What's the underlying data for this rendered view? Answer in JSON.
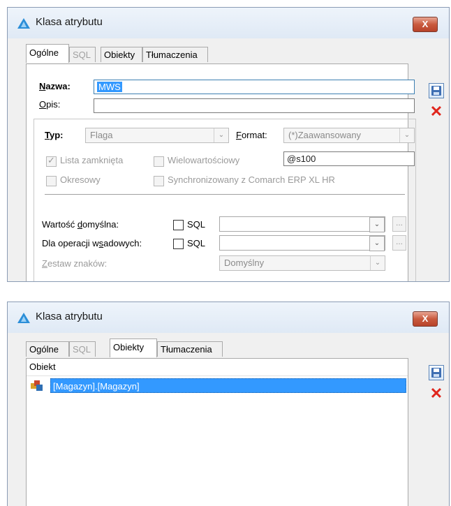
{
  "window_title": "Klasa atrybutu",
  "close_label": "X",
  "tabs": [
    {
      "label": "Ogólne"
    },
    {
      "label": "SQL"
    },
    {
      "label": "Obiekty"
    },
    {
      "label": "Tłumaczenia"
    }
  ],
  "general": {
    "nazwa_label": "Nazwa:",
    "nazwa_value": "MWS",
    "opis_label": "Opis:",
    "opis_value": "",
    "typ_label": "Typ:",
    "typ_value": "Flaga",
    "format_label": "Format:",
    "format_value": "(*)Zaawansowany",
    "format_mask": "@s100",
    "lista_zamknieta": "Lista zamknięta",
    "lista_zamknieta_checked": true,
    "wielowartosciowy": "Wielowartościowy",
    "okresowy": "Okresowy",
    "synchronizowany": "Synchronizowany z Comarch ERP XL HR",
    "wartosc_domyslna_label": "Wartość domyślna:",
    "dla_operacji_label": "Dla operacji wsadowych:",
    "sql_label": "SQL",
    "dots_label": "...",
    "zestaw_label": "Zestaw znaków:",
    "zestaw_value": "Domyślny"
  },
  "objects": {
    "column_header": "Obiekt",
    "rows": [
      "[Magazyn].[Magazyn]"
    ]
  },
  "colors": {
    "selection": "#3399ff",
    "delete_icon": "#e0251c",
    "save_icon": "#3f6fb3"
  },
  "icons": [
    "app-icon",
    "save-icon",
    "delete-icon",
    "object-icon",
    "chevron-down-icon"
  ]
}
